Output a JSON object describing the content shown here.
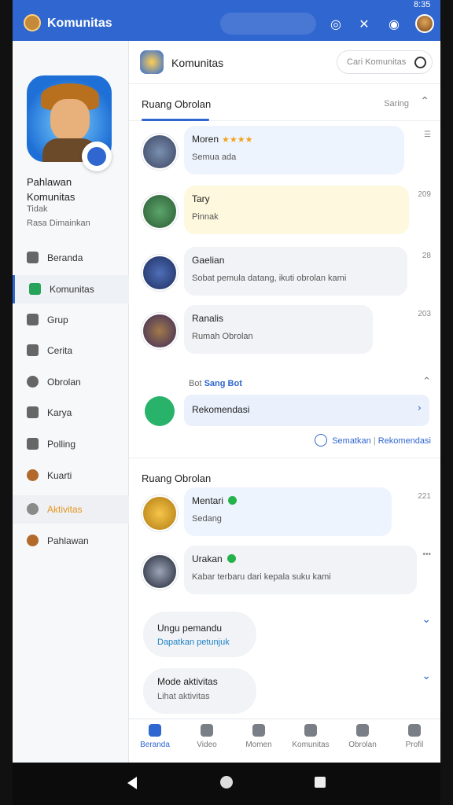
{
  "app_bar": {
    "title": "Komunitas",
    "status_time": "8:35"
  },
  "sidebar": {
    "profile_name": "Pahlawan Komunitas",
    "profile_sub1": "Tidak",
    "profile_sub2": "Rasa Dimainkan",
    "items": [
      {
        "label": "Beranda",
        "icon": "home-icon"
      },
      {
        "label": "Komunitas",
        "icon": "community-icon"
      },
      {
        "label": "Grup",
        "icon": "group-icon"
      },
      {
        "label": "Cerita",
        "icon": "pencil-icon"
      },
      {
        "label": "Obrolan",
        "icon": "chat-icon"
      },
      {
        "label": "Karya",
        "icon": "folder-icon"
      },
      {
        "label": "Polling",
        "icon": "poll-icon"
      },
      {
        "label": "Kuarti",
        "icon": "character-icon"
      },
      {
        "label": "Aktivitas",
        "icon": "activity-icon"
      },
      {
        "label": "Pahlawan",
        "icon": "hero-icon"
      }
    ]
  },
  "main": {
    "header_title": "Komunitas",
    "search_placeholder": "Cari Komunitas",
    "section1": {
      "title": "Ruang Obrolan",
      "right_label": "Saring"
    },
    "chats": [
      {
        "name": "Moren",
        "emoji": "★★★★",
        "message": "Semua ada",
        "time": ""
      },
      {
        "name": "Tary",
        "emoji": "",
        "message": "Pinnak",
        "time": "209"
      },
      {
        "name": "Gaelian",
        "emoji": "",
        "message": "Sobat pemula datang, ikuti obrolan kami",
        "time": "28"
      },
      {
        "name": "Ranalis",
        "emoji": "",
        "message": "Rumah Obrolan",
        "time": "203"
      }
    ],
    "bots": {
      "label": "Bot",
      "highlight": "Sang Bot",
      "featured_label": "Rekomendasi",
      "link_left": "Sematkan",
      "link_right": "Rekomendasi"
    },
    "section2": {
      "title": "Ruang Obrolan"
    },
    "chats2": [
      {
        "name": "Mentari",
        "message": "Sedang",
        "time": "221"
      },
      {
        "name": "Urakan",
        "message": "Kabar terbaru dari kepala suku kami",
        "time": "•••"
      }
    ],
    "pill1": {
      "title": "Ungu pemandu",
      "subtitle": "Dapatkan petunjuk"
    },
    "pill2": {
      "title": "Mode aktivitas",
      "subtitle": "Lihat aktivitas"
    }
  },
  "tabs": [
    {
      "label": "Beranda",
      "active": true
    },
    {
      "label": "Video",
      "active": false
    },
    {
      "label": "Momen",
      "active": false
    },
    {
      "label": "Komunitas",
      "active": false
    },
    {
      "label": "Obrolan",
      "active": false
    },
    {
      "label": "Profil",
      "active": false
    }
  ],
  "colors": {
    "brand": "#2f66cf",
    "online": "#24b24b",
    "highlight": "#e8951e"
  }
}
